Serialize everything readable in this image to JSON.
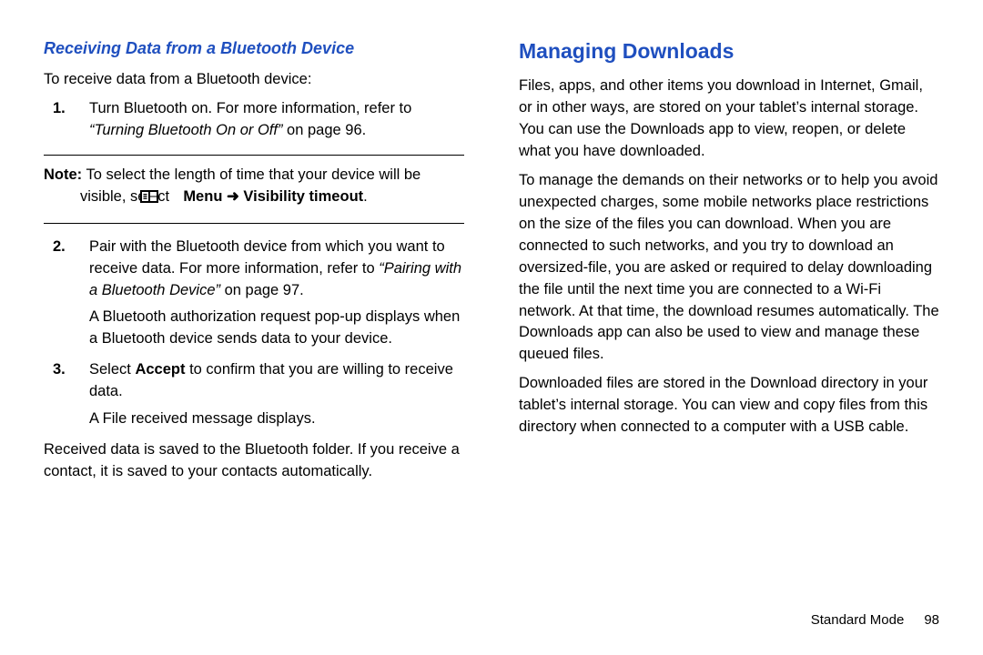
{
  "left": {
    "subhead": "Receiving Data from a Bluetooth Device",
    "intro": "To receive data from a Bluetooth device:",
    "items": [
      {
        "num": "1.",
        "l1": "Turn Bluetooth on. For more information, refer to ",
        "l2": "“Turning Bluetooth On or Off”",
        "l3": " on page 96."
      },
      {
        "num": "2.",
        "l1": "Pair with the Bluetooth device from which you want to receive data. For more information, refer to ",
        "l2": "“Pairing with a Bluetooth Device”",
        "l3": " on page 97.",
        "cont": "A Bluetooth authorization request pop-up displays when a Bluetooth device sends data to your device."
      },
      {
        "num": "3.",
        "l1": "Select ",
        "l2": "Accept",
        "l3": " to confirm that you are willing to receive data.",
        "cont": "A File received message displays."
      }
    ],
    "note": {
      "label": "Note:",
      "l1": " To select the length of time that your device will be visible, select ",
      "l2": "Menu",
      "l3": "Visibility timeout",
      "dot": "."
    },
    "after": "Received data is saved to the Bluetooth folder. If you receive a contact, it is saved to your contacts automatically."
  },
  "right": {
    "mainhead": "Managing Downloads",
    "p1": "Files, apps, and other items you download in Internet, Gmail, or in other ways, are stored on your tablet’s internal storage. You can use the Downloads app to view, reopen, or delete what you have downloaded.",
    "p2": "To manage the demands on their networks or to help you avoid unexpected charges, some mobile networks place restrictions on the size of the files you can download. When you are connected to such networks, and you try to download an oversized-file, you are asked or required to delay downloading the file until the next time you are connected to a Wi-Fi network. At that time, the download resumes automatically. The Downloads app can also be used to view and manage these queued files.",
    "p3": "Downloaded files are stored in the Download directory in your tablet’s internal storage. You can view and copy files from this directory when connected to a computer with a USB cable."
  },
  "footer": {
    "label": "Standard Mode",
    "page": "98"
  }
}
